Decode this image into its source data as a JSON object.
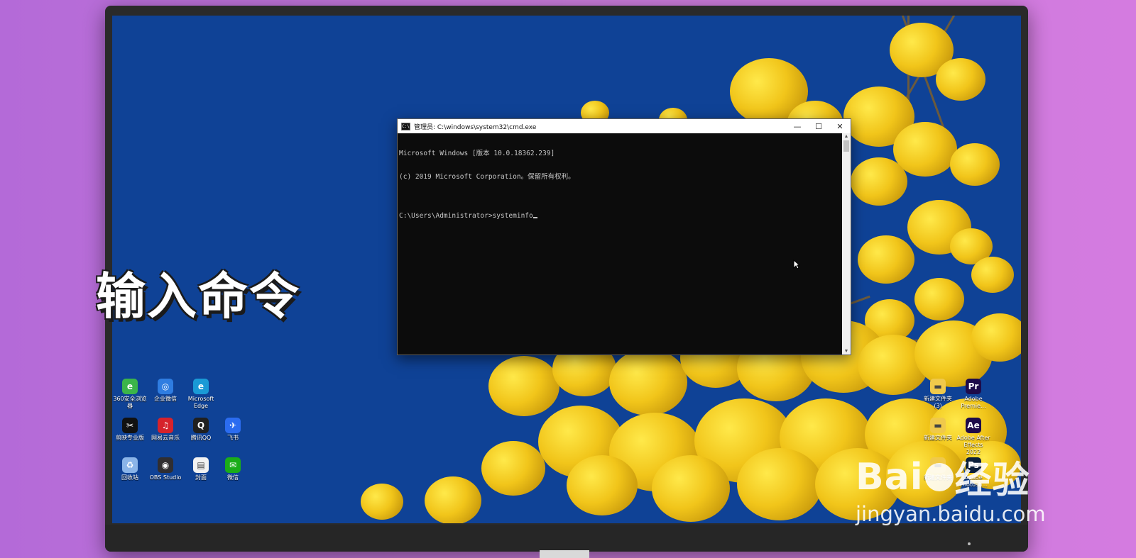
{
  "caption": "输入命令",
  "cmd": {
    "title": "管理员: C:\\windows\\system32\\cmd.exe",
    "lines": [
      "Microsoft Windows [版本 10.0.18362.239]",
      "(c) 2019 Microsoft Corporation。保留所有权利。",
      "",
      "C:\\Users\\Administrator>systeminfo"
    ],
    "minimize": "—",
    "maximize": "☐",
    "close": "✕"
  },
  "desktop_left": [
    {
      "label": "360安全浏览器",
      "icon": "browser-360-icon",
      "color": "#3bb54a",
      "glyph": "e"
    },
    {
      "label": "企业微信",
      "icon": "wecom-icon",
      "color": "#2f7de1",
      "glyph": "◎"
    },
    {
      "label": "Microsoft Edge",
      "icon": "edge-icon",
      "color": "#1a9ad6",
      "glyph": "e"
    },
    {
      "label": "剪映专业版",
      "icon": "capcut-icon",
      "color": "#111111",
      "glyph": "✂"
    },
    {
      "label": "网易云音乐",
      "icon": "netease-music-icon",
      "color": "#d6222b",
      "glyph": "♫"
    },
    {
      "label": "腾讯QQ",
      "icon": "qq-icon",
      "color": "#202020",
      "glyph": "Q"
    },
    {
      "label": "飞书",
      "icon": "feishu-icon",
      "color": "#2b6cf0",
      "glyph": "✈"
    },
    {
      "label": "回收站",
      "icon": "recycle-bin-icon",
      "color": "#8ab4e8",
      "glyph": "♻"
    },
    {
      "label": "OBS Studio",
      "icon": "obs-icon",
      "color": "#302e31",
      "glyph": "◉"
    },
    {
      "label": "封面",
      "icon": "document-icon",
      "color": "#f2f2f2",
      "glyph": "▤"
    },
    {
      "label": "微信",
      "icon": "wechat-icon",
      "color": "#1aad19",
      "glyph": "✉"
    }
  ],
  "desktop_right": [
    {
      "label": "新建文件夹 (3)",
      "icon": "folder-icon",
      "color": "#f0c94b",
      "glyph": "▬"
    },
    {
      "label": "Adobe Premie...",
      "icon": "premiere-icon",
      "color": "#1d0b4a",
      "glyph": "Pr"
    },
    {
      "label": "新建文件夹",
      "icon": "folder-icon",
      "color": "#f0c94b",
      "glyph": "▬"
    },
    {
      "label": "Adobe After Effects 2022",
      "icon": "after-effects-icon",
      "color": "#1d0b4a",
      "glyph": "Ae"
    },
    {
      "label": "新建文件夹",
      "icon": "folder-icon",
      "color": "#f0c94b",
      "glyph": "▬"
    },
    {
      "label": "Adobe Photosh...",
      "icon": "photoshop-icon",
      "color": "#0b1f3a",
      "glyph": "Ps"
    }
  ],
  "watermark": {
    "logo_left": "Bai",
    "logo_right": "经验",
    "url": "jingyan.baidu.com"
  }
}
